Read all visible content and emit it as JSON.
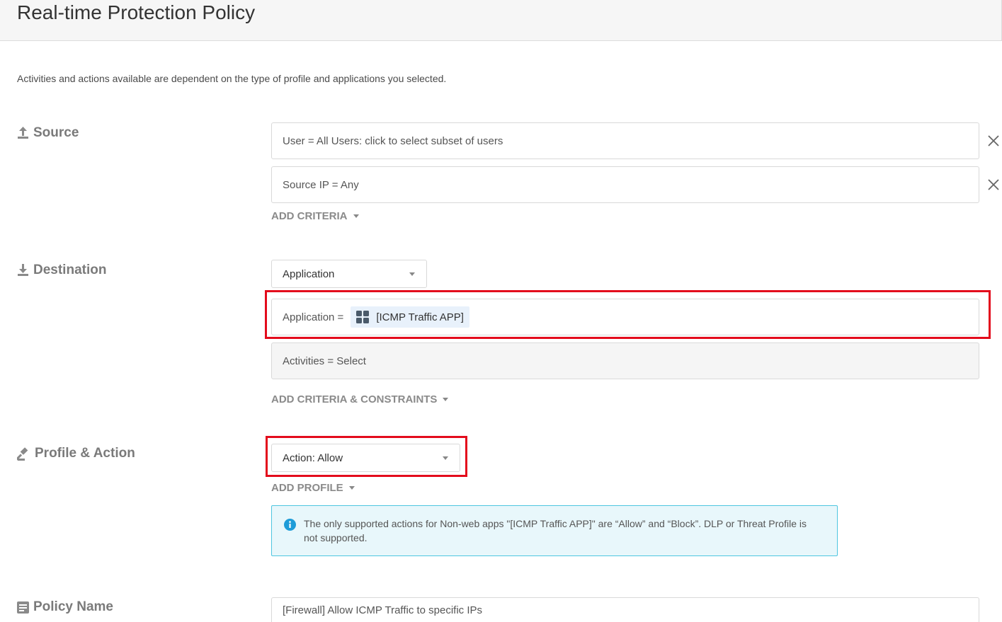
{
  "page": {
    "title": "Real-time Protection Policy",
    "description": "Activities and actions available are dependent on the type of profile and applications you selected."
  },
  "source": {
    "label": "Source",
    "fields": [
      "User = All Users: click to select subset of users",
      "Source IP = Any"
    ],
    "add_criteria": "ADD CRITERIA"
  },
  "destination": {
    "label": "Destination",
    "type_select": "Application",
    "application_prefix": "Application =",
    "application_value": "[ICMP Traffic APP]",
    "activities": "Activities = Select",
    "add_criteria": "ADD CRITERIA & CONSTRAINTS"
  },
  "profile_action": {
    "label": "Profile & Action",
    "action_select": "Action: Allow",
    "add_profile": "ADD PROFILE",
    "info": "The only supported actions for Non-web apps \"[ICMP Traffic APP]\" are “Allow” and “Block”. DLP or Threat Profile is not supported."
  },
  "policy_name": {
    "label": "Policy Name",
    "value": "[Firewall] Allow ICMP Traffic to specific IPs"
  },
  "colors": {
    "highlight": "#e30b1c",
    "info_border": "#4ec6e0",
    "info_icon": "#1e9cd8",
    "chip_bg": "#e8f1fb"
  }
}
